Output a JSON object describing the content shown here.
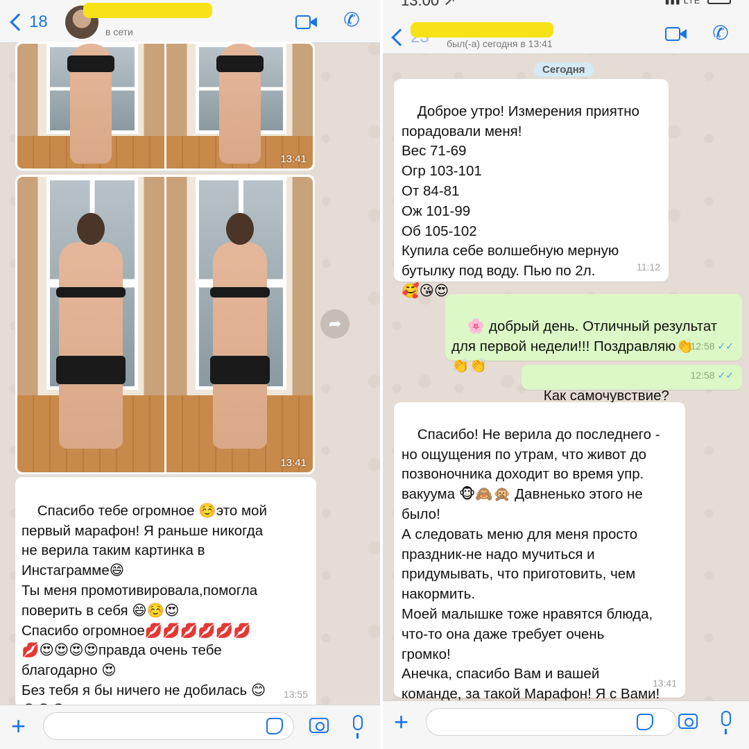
{
  "left": {
    "header": {
      "back_count": "18",
      "status": "в сети"
    },
    "photos": [
      {
        "time": "13:41"
      },
      {
        "time": "13:41"
      }
    ],
    "message": {
      "text": "Спасибо тебе огромное ☺️это мой\nпервый марафон! Я раньше никогда\nне верила таким картинка в\nИнстаграмме😄\nТы меня промотивировала,помогла\nповерить в себя 😄☺️😍\nСпасибо огромное💋💋💋💋💋💋\n💋😍😍😍😍правда очень тебе\nблагодарно 😍\nБез тебя я бы ничего не добилась 😊\n😘😘😘",
      "time": "13:55"
    }
  },
  "right": {
    "status_bar": {
      "clock": "13:00 ↗",
      "signal": "▮▮▮ LTE"
    },
    "header": {
      "back_count": "23",
      "status": "был(-а) сегодня в 13:41"
    },
    "date_pill": "Сегодня",
    "messages": [
      {
        "direction": "in",
        "text": "Доброе утро! Измерения приятно\nпорадовали меня!\nВес 71-69\nОгр 103-101\nОт 84-81\nОж 101-99\nОб 105-102\nКупила себе волшебную мерную\nбутылку под воду. Пью по 2л.\n🥰😘😍",
        "time": "11:12"
      },
      {
        "direction": "out",
        "text": "🌸 добрый день. Отличный результат\nдля первой недели!!! Поздравляю👏\n👏👏",
        "time": "12:58"
      },
      {
        "direction": "out",
        "text": "Как самочувствие?",
        "time": "12:58"
      },
      {
        "direction": "in",
        "text": "Спасибо! Не верила до последнего -\nно ощущения по утрам, что живот до\nпозвоночника доходит во время упр.\nвакуума 🐵🙈🙊 Давненько этого не\nбыло!\nА следовать меню для меня просто\nпраздник-не надо мучиться и\nпридумывать, что приготовить, чем\nнакормить.\nМоей малышке тоже нравятся блюда,\nчто-то она даже требует очень\nгромко!\nАнечка, спасибо Вам и вашей\nкоманде, за такой Марафон! Я с Вами!",
        "time": "13:41"
      }
    ]
  },
  "read_ticks": "✓✓",
  "colors": {
    "accent": "#1a73e8",
    "incoming": "#ffffff",
    "outgoing": "#dcf8c6",
    "highlight": "#f7e217"
  },
  "icons": [
    "chevron-left-icon",
    "video-call-icon",
    "phone-icon",
    "plus-icon",
    "sticker-icon",
    "camera-icon",
    "microphone-icon",
    "forward-icon"
  ]
}
